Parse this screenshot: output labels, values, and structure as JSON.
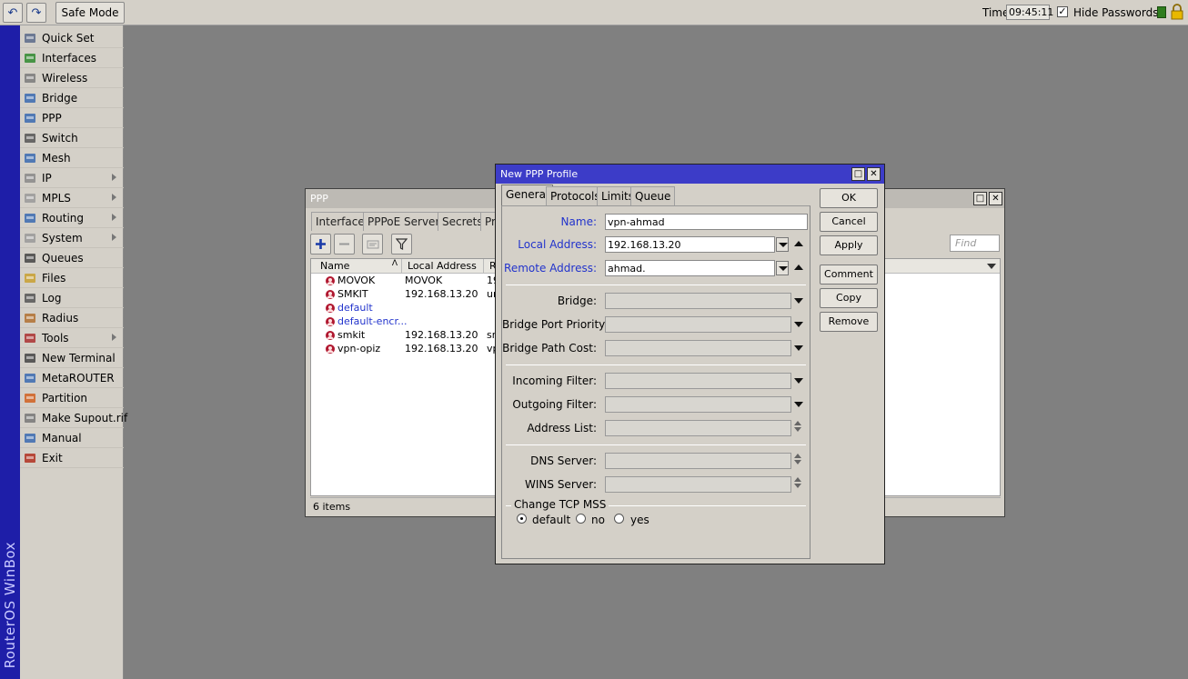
{
  "toolbar": {
    "safe_mode_label": "Safe Mode",
    "time_label": "Time",
    "time_value": "09:45:11",
    "hide_passwords_label": "Hide Passwords",
    "hide_passwords_checked": true
  },
  "sidebar": {
    "brand": "RouterOS WinBox",
    "items": [
      {
        "label": "Quick Set",
        "icon": "quick-set-icon",
        "submenu": false
      },
      {
        "label": "Interfaces",
        "icon": "interfaces-icon",
        "submenu": false
      },
      {
        "label": "Wireless",
        "icon": "wireless-icon",
        "submenu": false
      },
      {
        "label": "Bridge",
        "icon": "bridge-icon",
        "submenu": false
      },
      {
        "label": "PPP",
        "icon": "ppp-icon",
        "submenu": false
      },
      {
        "label": "Switch",
        "icon": "switch-icon",
        "submenu": false
      },
      {
        "label": "Mesh",
        "icon": "mesh-icon",
        "submenu": false
      },
      {
        "label": "IP",
        "icon": "ip-icon",
        "submenu": true
      },
      {
        "label": "MPLS",
        "icon": "mpls-icon",
        "submenu": true
      },
      {
        "label": "Routing",
        "icon": "routing-icon",
        "submenu": true
      },
      {
        "label": "System",
        "icon": "system-icon",
        "submenu": true
      },
      {
        "label": "Queues",
        "icon": "queues-icon",
        "submenu": false
      },
      {
        "label": "Files",
        "icon": "files-icon",
        "submenu": false
      },
      {
        "label": "Log",
        "icon": "log-icon",
        "submenu": false
      },
      {
        "label": "Radius",
        "icon": "radius-icon",
        "submenu": false
      },
      {
        "label": "Tools",
        "icon": "tools-icon",
        "submenu": true
      },
      {
        "label": "New Terminal",
        "icon": "terminal-icon",
        "submenu": false
      },
      {
        "label": "MetaROUTER",
        "icon": "metarouter-icon",
        "submenu": false
      },
      {
        "label": "Partition",
        "icon": "partition-icon",
        "submenu": false
      },
      {
        "label": "Make Supout.rif",
        "icon": "supout-icon",
        "submenu": false
      },
      {
        "label": "Manual",
        "icon": "manual-icon",
        "submenu": false
      },
      {
        "label": "Exit",
        "icon": "exit-icon",
        "submenu": false
      }
    ]
  },
  "ppp_window": {
    "title": "PPP",
    "tabs": [
      "Interface",
      "PPPoE Servers",
      "Secrets",
      "Pr"
    ],
    "find_placeholder": "Find",
    "columns": [
      "Name",
      "Local Address",
      "Re"
    ],
    "rows": [
      {
        "name": "MOVOK",
        "local": "MOVOK",
        "remote": "19",
        "default": false
      },
      {
        "name": "SMKIT",
        "local": "192.168.13.20",
        "remote": "ur",
        "default": false
      },
      {
        "name": "default",
        "local": "",
        "remote": "",
        "default": true
      },
      {
        "name": "default-encr...",
        "local": "",
        "remote": "",
        "default": true
      },
      {
        "name": "smkit",
        "local": "192.168.13.20",
        "remote": "sm",
        "default": false
      },
      {
        "name": "vpn-opiz",
        "local": "192.168.13.20",
        "remote": "vp",
        "default": false
      }
    ],
    "status": "6 items"
  },
  "dialog": {
    "title": "New PPP Profile",
    "tabs": [
      "General",
      "Protocols",
      "Limits",
      "Queue"
    ],
    "active_tab": "General",
    "fields": {
      "name": {
        "label": "Name:",
        "value": "vpn-ahmad"
      },
      "local_address": {
        "label": "Local Address:",
        "value": "192.168.13.20"
      },
      "remote_address": {
        "label": "Remote Address:",
        "value": "ahmad."
      },
      "bridge": {
        "label": "Bridge:",
        "value": ""
      },
      "bridge_port_priority": {
        "label": "Bridge Port Priority:",
        "value": ""
      },
      "bridge_path_cost": {
        "label": "Bridge Path Cost:",
        "value": ""
      },
      "incoming_filter": {
        "label": "Incoming Filter:",
        "value": ""
      },
      "outgoing_filter": {
        "label": "Outgoing Filter:",
        "value": ""
      },
      "address_list": {
        "label": "Address List:",
        "value": ""
      },
      "dns_server": {
        "label": "DNS Server:",
        "value": ""
      },
      "wins_server": {
        "label": "WINS Server:",
        "value": ""
      }
    },
    "change_tcp_mss": {
      "label": "Change TCP MSS",
      "options": [
        "default",
        "no",
        "yes"
      ],
      "selected": "default"
    },
    "buttons": {
      "ok": "OK",
      "cancel": "Cancel",
      "apply": "Apply",
      "comment": "Comment",
      "copy": "Copy",
      "remove": "Remove"
    }
  },
  "colors": {
    "accent": "#3c3cc8",
    "brand_strip": "#1e1ea8",
    "field_label_blue": "#2233cc",
    "desktop": "#808080"
  }
}
